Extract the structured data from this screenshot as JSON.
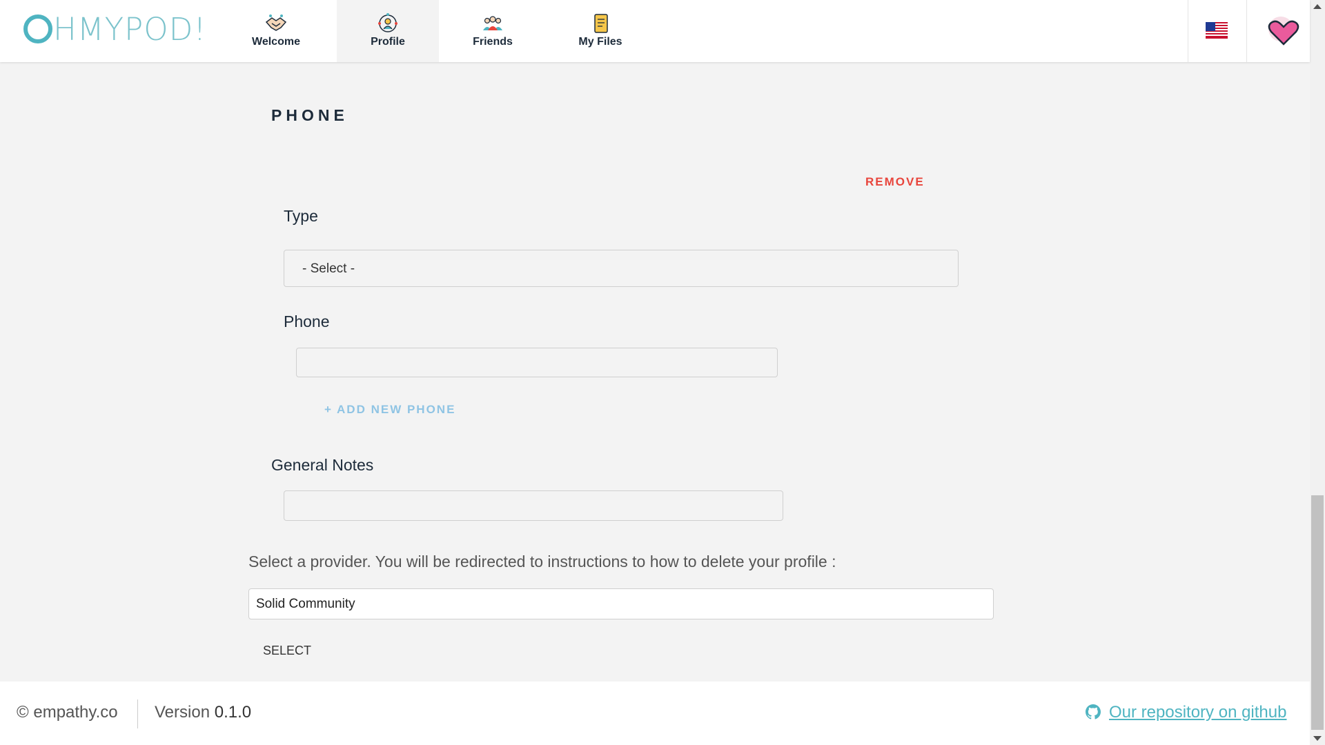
{
  "header": {
    "logo_text": "HMYPOD!",
    "nav": [
      {
        "label": "Welcome",
        "icon": "handshake-icon"
      },
      {
        "label": "Profile",
        "icon": "profile-network-icon"
      },
      {
        "label": "Friends",
        "icon": "friends-group-icon"
      },
      {
        "label": "My Files",
        "icon": "document-files-icon"
      }
    ],
    "active_tab": "Profile",
    "language_flag": "us-flag-icon",
    "avatar": "heart-avatar-icon"
  },
  "phone_section": {
    "title": "PHONE",
    "remove_label": "REMOVE",
    "type_label": "Type",
    "type_value": "- Select -",
    "phone_label": "Phone",
    "phone_value": "",
    "add_phone_label": "+ ADD NEW PHONE"
  },
  "notes": {
    "label": "General Notes",
    "value": ""
  },
  "provider": {
    "instruction": "Select a provider. You will be redirected to instructions to how to delete your profile :",
    "selected": "Solid Community",
    "select_button": "SELECT"
  },
  "footer": {
    "copyright": "© empathy.co",
    "version_label": "Version",
    "version_value": "0.1.0",
    "github_link": "Our repository on github"
  },
  "colors": {
    "accent": "#4fb4c1",
    "remove": "#e8453c",
    "add_link": "#8fc4e4",
    "heading": "#1d2b3a",
    "background": "#f3f3f3"
  }
}
